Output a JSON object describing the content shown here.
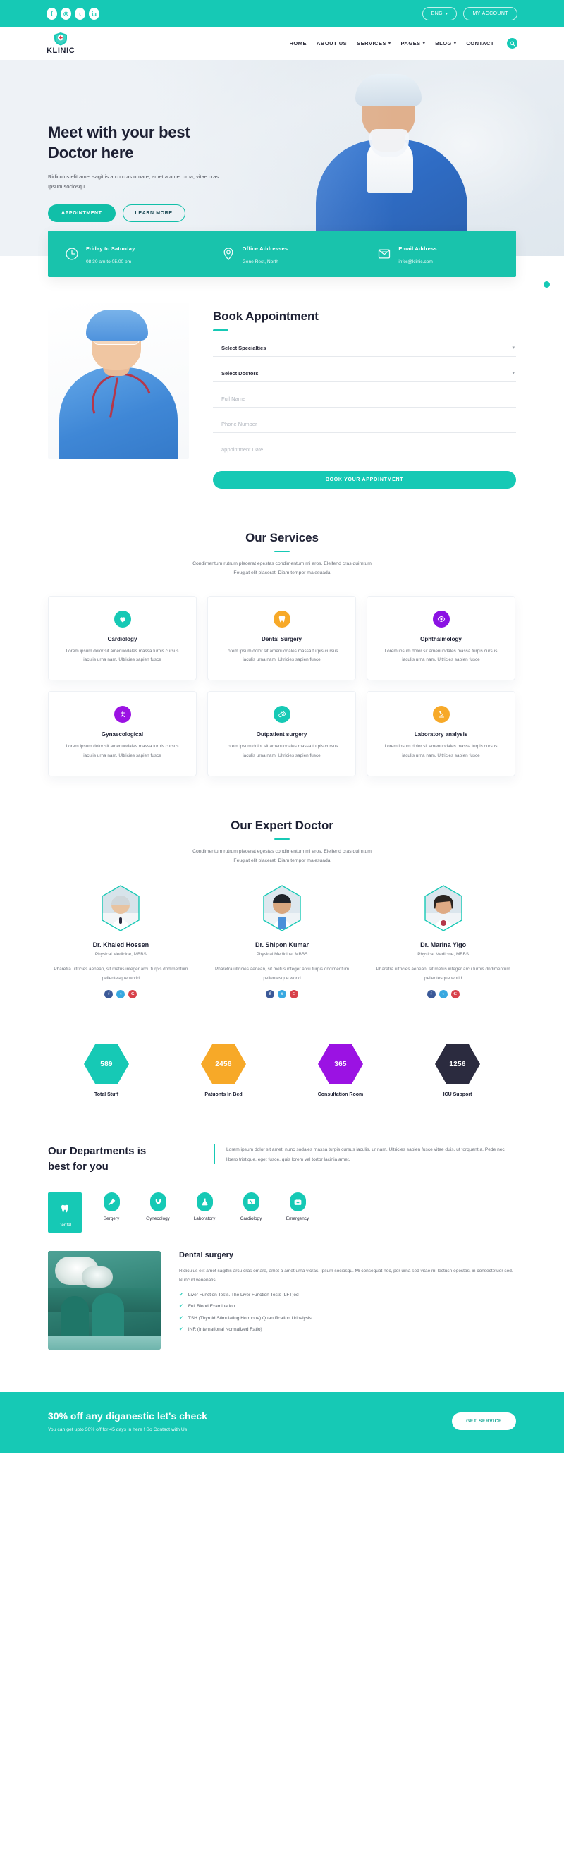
{
  "topbar": {
    "socials": [
      {
        "name": "facebook-icon",
        "glyph": "f"
      },
      {
        "name": "instagram-icon",
        "glyph": "◎"
      },
      {
        "name": "twitter-icon",
        "glyph": "t"
      },
      {
        "name": "linkedin-icon",
        "glyph": "in"
      }
    ],
    "language": "ENG",
    "account": "MY ACCOUNT"
  },
  "nav": {
    "brand": "KLINIC",
    "items": [
      {
        "label": "HOME",
        "caret": false
      },
      {
        "label": "ABOUT US",
        "caret": false
      },
      {
        "label": "SERVICES",
        "caret": true
      },
      {
        "label": "PAGES",
        "caret": true
      },
      {
        "label": "BLOG",
        "caret": true
      },
      {
        "label": "CONTACT",
        "caret": false
      }
    ]
  },
  "hero": {
    "title_line1": "Meet with your best",
    "title_line2": "Doctor here",
    "subtitle": "Ridiculus elit amet sagittis arcu cras ornare, amet a amet urna, vitae cras. Ipsum sociosqu.",
    "primary_button": "APPOINTMENT",
    "secondary_button": "LEARN MORE"
  },
  "infobar": [
    {
      "icon": "clock-icon",
      "title": "Friday to Saturday",
      "text": "08.30 am to 05.00 pm"
    },
    {
      "icon": "location-pin-icon",
      "title": "Office Addresses",
      "text": "Gene Rest, North"
    },
    {
      "icon": "envelope-icon",
      "title": "Email Address",
      "text": "infor@klinic.com"
    }
  ],
  "appointment": {
    "title": "Book Appointment",
    "select_specialties": "Select Specialties",
    "select_doctors": "Select Doctors",
    "full_name_placeholder": "Full Name",
    "phone_placeholder": "Phone Number",
    "date_placeholder": "appointment Date",
    "submit": "BOOK YOUR APPOINTMENT"
  },
  "services": {
    "title": "Our Services",
    "desc_line1": "Condimentum rutrum placerat egestas condimentum mi eros. Eleifend cras quirntum",
    "desc_line2": "Feugiat elit placerat. Diam tempor malesuada",
    "body": "Lorem ipsum dolor sit amenuodales massa turpis cursus iaculis urna nam. Ultricies sapien fusce",
    "cards": [
      {
        "name": "Cardiology",
        "icon": "heartbeat-icon",
        "color": "#16c9b5"
      },
      {
        "name": "Dental Surgery",
        "icon": "tooth-icon",
        "color": "#f7a928"
      },
      {
        "name": "Ophthalmology",
        "icon": "eye-icon",
        "color": "#8b12e3"
      },
      {
        "name": "Gynaecological",
        "icon": "gynaecology-icon",
        "color": "#9b12e3"
      },
      {
        "name": "Outpatient surgery",
        "icon": "pills-icon",
        "color": "#16c9b5"
      },
      {
        "name": "Laboratory analysis",
        "icon": "microscope-icon",
        "color": "#f7a928"
      }
    ]
  },
  "doctors": {
    "title": "Our Expert Doctor",
    "desc_line1": "Condimentum rutrum placerat egestas condimentum mi eros. Eleifend cras quirntum",
    "desc_line2": "Feugiat elit placerat. Diam tempor malesuada",
    "bio": "Pharetra ultricies aenean, sit metus integer arcu turpis dndimentum pellentesque world",
    "role": "Physical Medicine, MBBS",
    "socials": [
      {
        "name": "facebook-icon",
        "glyph": "f",
        "color": "#3b5998"
      },
      {
        "name": "twitter-icon",
        "glyph": "t",
        "color": "#38a8e0"
      },
      {
        "name": "google-plus-icon",
        "glyph": "G",
        "color": "#d8414a"
      }
    ],
    "list": [
      {
        "name": "Dr. Khaled Hossen"
      },
      {
        "name": "Dr. Shipon Kumar"
      },
      {
        "name": "Dr. Marina Yigo"
      }
    ]
  },
  "counters": [
    {
      "value": "589",
      "label": "Total Stuff",
      "color": "#16c9b5"
    },
    {
      "value": "2458",
      "label": "Patuonts In Bed",
      "color": "#f7a928"
    },
    {
      "value": "365",
      "label": "Consultation Room",
      "color": "#9b12e3"
    },
    {
      "value": "1256",
      "label": "ICU Support",
      "color": "#2b2b3f"
    }
  ],
  "departments": {
    "title_line1": "Our Departments is",
    "title_line2": "best for you",
    "desc": "Lorem ipsum dolor sit amet, nunc sodales massa turpis cursus iaculis, ur nam. Ultricies sapien fusce vitae duis, ut torquent a. Pede nec libero tristique, eget fusce, quis lorem vel tortor lacinia amet.",
    "tabs": [
      {
        "label": "Dental",
        "icon": "tooth-icon",
        "active": true
      },
      {
        "label": "Sergery",
        "icon": "scalpel-icon",
        "active": false
      },
      {
        "label": "Gynecology",
        "icon": "uterus-icon",
        "active": false
      },
      {
        "label": "Laboratory",
        "icon": "flask-icon",
        "active": false
      },
      {
        "label": "Cardiology",
        "icon": "ecg-monitor-icon",
        "active": false
      },
      {
        "label": "Emergency",
        "icon": "first-aid-kit-icon",
        "active": false
      }
    ],
    "panel": {
      "title": "Dental surgery",
      "text": "Ridiculus elit amet sagittis arcu cras ornare, amet a amet urna vicras. Ipsum sociosqu. Mi consequat nec, per urna sed vitae mi lectusn egestas, in consectetuer sed. Nunc id venenatis",
      "checks": [
        "Liver Function Tests. The Liver Function Tests (LFT)ed",
        "Full Blood Examination.",
        "TSH (Thyroid Stimulating Hormone) Quantification Urinalysis.",
        "INR (International Normalized Ratio)"
      ]
    }
  },
  "cta": {
    "title": "30% off any diganestic let's check",
    "subtitle": "You can get upto 30% off for 45 days in here ! So Contact with Us",
    "button": "GET SERVICE"
  },
  "colors": {
    "brand": "#16c9b5",
    "brand_dark": "#11bfa8",
    "orange": "#f7a928",
    "purple": "#9b12e3",
    "dark": "#2b2b3f"
  }
}
